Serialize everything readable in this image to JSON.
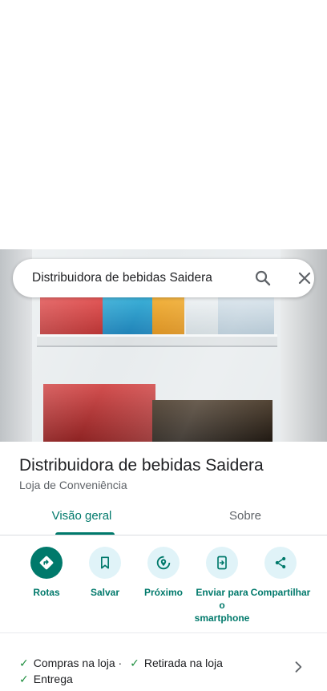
{
  "search": {
    "query": "Distribuidora de bebidas Saidera"
  },
  "place": {
    "name": "Distribuidora de bebidas Saidera",
    "category": "Loja de Conveniência"
  },
  "tabs": [
    {
      "label": "Visão geral",
      "active": true
    },
    {
      "label": "Sobre",
      "active": false
    }
  ],
  "actions": [
    {
      "label": "Rotas",
      "icon": "directions-icon"
    },
    {
      "label": "Salvar",
      "icon": "bookmark-icon"
    },
    {
      "label": "Próximo",
      "icon": "nearby-icon"
    },
    {
      "label": "Enviar para o smartphone",
      "icon": "send-to-phone-icon"
    },
    {
      "label": "Compartilhar",
      "icon": "share-icon"
    }
  ],
  "services": {
    "line1_a": "Compras na loja ·",
    "line1_b": "Retirada na loja",
    "line2": "Entrega"
  },
  "colors": {
    "accent": "#00796b",
    "chip_bg": "#e0f3f8",
    "check": "#1e8e3e"
  }
}
